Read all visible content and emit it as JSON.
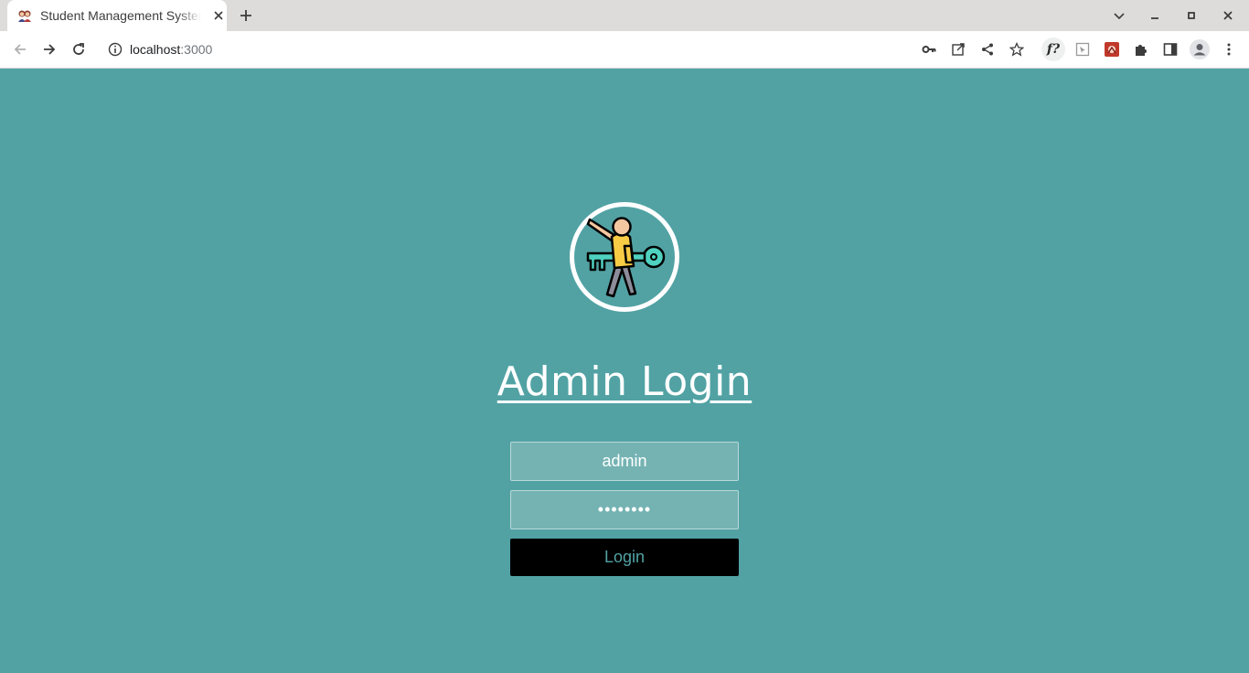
{
  "browser": {
    "tab": {
      "title": "Student Management System",
      "favicon": "students-favicon"
    },
    "new_tab_icon": "plus-icon",
    "window_controls": [
      "chevron-down-icon",
      "minimize-icon",
      "maximize-icon",
      "close-icon"
    ],
    "nav_icons": [
      "back-icon",
      "forward-icon",
      "reload-icon"
    ],
    "address": {
      "host": "localhost",
      "port": ":3000",
      "security_icon": "info-icon"
    },
    "toolbar_icons": [
      "key-icon",
      "open-external-icon",
      "share-icon",
      "star-icon",
      "font-ext-icon",
      "cursor-ext-icon",
      "red-ext-icon",
      "puzzle-icon",
      "sidepanel-icon",
      "profile-icon",
      "menu-icon"
    ],
    "font_ext_label": "f?"
  },
  "page": {
    "background": "#52a2a4",
    "logo_icon": "person-with-key-icon",
    "title": "Admin Login",
    "username": {
      "value": "admin"
    },
    "password": {
      "value": "••••••••"
    },
    "login_button": "Login"
  }
}
